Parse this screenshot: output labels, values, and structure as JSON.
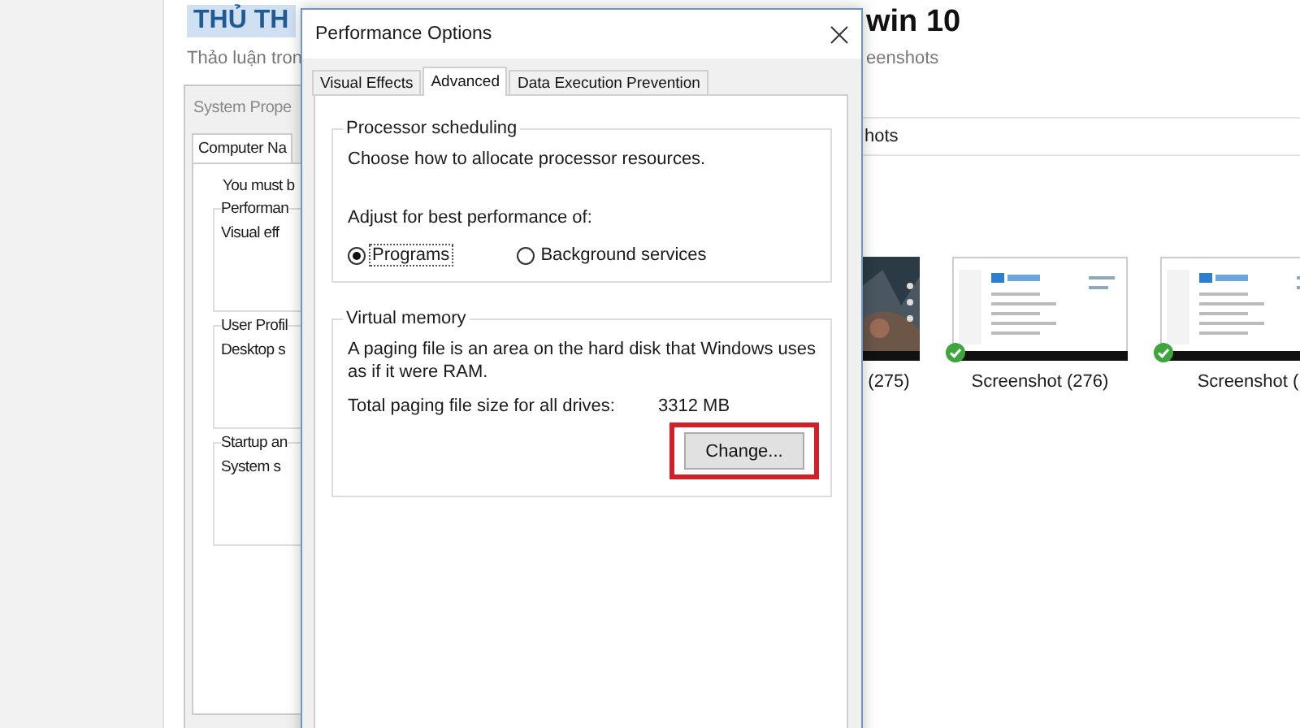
{
  "page": {
    "heading_highlight": "THỦ TH",
    "heading_tail": "win 10",
    "subtitle_left": "Thảo luận tron",
    "subtitle_right": "eenshots"
  },
  "system_properties": {
    "title": "System Prope",
    "tab": "Computer Na",
    "note": "You must b",
    "groups": [
      {
        "label": "Performan",
        "text": "Visual eff"
      },
      {
        "label": "User Profil",
        "text": "Desktop s"
      },
      {
        "label": "Startup an",
        "text": "System s"
      }
    ]
  },
  "explorer": {
    "breadcrumb": "hots",
    "items": [
      {
        "label": "(275)",
        "checked": false
      },
      {
        "label": "Screenshot (276)",
        "kind": "document",
        "checked": true
      },
      {
        "label": "Screenshot (",
        "kind": "document",
        "checked": true
      }
    ]
  },
  "dialog": {
    "title": "Performance Options",
    "tabs": [
      {
        "label": "Visual Effects",
        "selected": false
      },
      {
        "label": "Advanced",
        "selected": true
      },
      {
        "label": "Data Execution Prevention",
        "selected": false
      }
    ],
    "processor": {
      "title": "Processor scheduling",
      "description": "Choose how to allocate processor resources.",
      "adjust_label": "Adjust for best performance of:",
      "options": [
        {
          "label": "Programs",
          "selected": true
        },
        {
          "label": "Background services",
          "selected": false
        }
      ]
    },
    "virtual_memory": {
      "title": "Virtual memory",
      "description": "A paging file is an area on the hard disk that Windows uses as if it were RAM.",
      "total_label": "Total paging file size for all drives:",
      "total_value": "3312 MB",
      "button": {
        "label": "Change...",
        "highlighted": true
      }
    }
  }
}
